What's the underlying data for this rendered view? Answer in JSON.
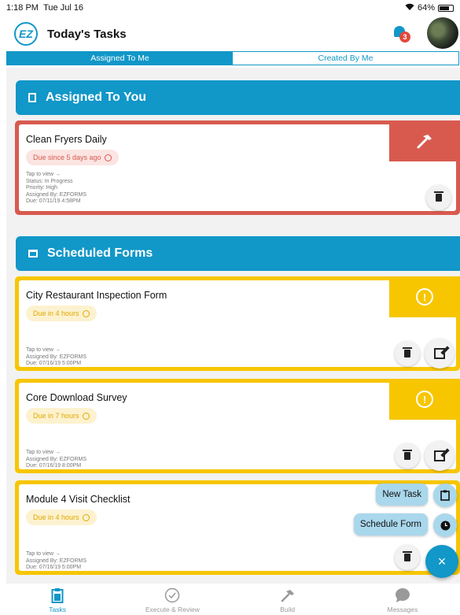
{
  "status_bar": {
    "time": "1:18 PM",
    "date": "Tue Jul 16",
    "battery": "64%",
    "battery_level": 0.64
  },
  "header": {
    "logo_text": "EZ",
    "title": "Today's Tasks",
    "notification_count": "3"
  },
  "tabs": [
    {
      "label": "Assigned To Me",
      "active": true
    },
    {
      "label": "Created By Me",
      "active": false
    }
  ],
  "sections": {
    "assigned": {
      "title": "Assigned To You",
      "icon": "clipboard-icon"
    },
    "scheduled": {
      "title": "Scheduled Forms",
      "icon": "calendar-icon"
    }
  },
  "assigned_task": {
    "title": "Clean Fryers Daily",
    "due": "Due since 5 days ago",
    "meta": [
      "Tap to view →",
      "Status: In Progress",
      "Priority: High",
      "Assigned By: EZFORMS",
      "Due: 07/11/19 4:58PM"
    ]
  },
  "forms": [
    {
      "title": "City Restaurant Inspection Form",
      "due": "Due in 4 hours",
      "meta": [
        "Tap to view →",
        "Assigned By: EZFORMS",
        "Due: 07/16/19 5:00PM"
      ]
    },
    {
      "title": "Core Download Survey",
      "due": "Due in 7 hours",
      "meta": [
        "Tap to view →",
        "Assigned By: EZFORMS",
        "Due: 07/16/19 8:00PM"
      ]
    },
    {
      "title": "Module 4 Visit Checklist",
      "due": "Due in 4 hours",
      "meta": [
        "Tap to view →",
        "Assigned By: EZFORMS",
        "Due: 07/16/19 5:00PM"
      ]
    }
  ],
  "fab": {
    "new_task": "New Task",
    "schedule_form": "Schedule Form",
    "close": "×"
  },
  "bottom_nav": [
    {
      "label": "Tasks",
      "icon": "clipboard-icon",
      "active": true
    },
    {
      "label": "Execute & Review",
      "icon": "check-circle-icon",
      "active": false
    },
    {
      "label": "Build",
      "icon": "hammer-icon",
      "active": false
    },
    {
      "label": "Messages",
      "icon": "chat-bubble-icon",
      "active": false
    }
  ],
  "colors": {
    "accent": "#1197c8",
    "overdue": "#d85a4f",
    "due_soon": "#f7c600"
  }
}
